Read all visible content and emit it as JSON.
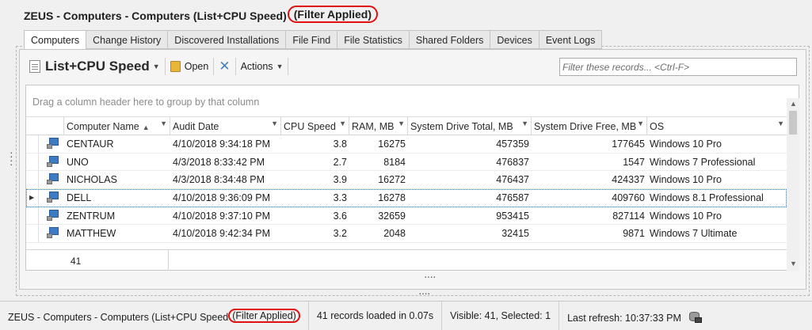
{
  "window": {
    "title": "ZEUS - Computers - Computers (List+CPU Speed)",
    "title_filter": "(Filter Applied)"
  },
  "tabs": [
    {
      "label": "Computers",
      "active": true
    },
    {
      "label": "Change History"
    },
    {
      "label": "Discovered Installations"
    },
    {
      "label": "File Find"
    },
    {
      "label": "File Statistics"
    },
    {
      "label": "Shared Folders"
    },
    {
      "label": "Devices"
    },
    {
      "label": "Event Logs"
    }
  ],
  "toolbar": {
    "view_name": "List+CPU Speed",
    "open_label": "Open",
    "actions_label": "Actions"
  },
  "filter": {
    "placeholder": "Filter these records... <Ctrl-F>"
  },
  "grid": {
    "group_panel_text": "Drag a column header here to group by that column",
    "columns": [
      "Computer Name",
      "Audit Date",
      "CPU Speed",
      "RAM, MB",
      "System Drive Total, MB",
      "System Drive Free, MB",
      "OS"
    ],
    "rows": [
      {
        "name": "CENTAUR",
        "date": "4/10/2018 9:34:18 PM",
        "cpu": "3.8",
        "ram": "16275",
        "total": "457359",
        "free": "177645",
        "os": "Windows 10 Pro"
      },
      {
        "name": "UNO",
        "date": "4/3/2018 8:33:42 PM",
        "cpu": "2.7",
        "ram": "8184",
        "total": "476837",
        "free": "1547",
        "os": "Windows 7 Professional"
      },
      {
        "name": "NICHOLAS",
        "date": "4/3/2018 8:34:48 PM",
        "cpu": "3.9",
        "ram": "16272",
        "total": "476437",
        "free": "424337",
        "os": "Windows 10 Pro"
      },
      {
        "name": "DELL",
        "date": "4/10/2018 9:36:09 PM",
        "cpu": "3.3",
        "ram": "16278",
        "total": "476587",
        "free": "409760",
        "os": "Windows 8.1 Professional",
        "selected": true
      },
      {
        "name": "ZENTRUM",
        "date": "4/10/2018 9:37:10 PM",
        "cpu": "3.6",
        "ram": "32659",
        "total": "953415",
        "free": "827114",
        "os": "Windows 10 Pro"
      },
      {
        "name": "MATTHEW",
        "date": "4/10/2018 9:42:34 PM",
        "cpu": "3.2",
        "ram": "2048",
        "total": "32415",
        "free": "9871",
        "os": "Windows 7 Ultimate"
      }
    ],
    "footer_count": "41"
  },
  "status_bar": {
    "title": "ZEUS - Computers - Computers (List+CPU Speed",
    "filter": "(Filter Applied)",
    "records": "41 records loaded in 0.07s",
    "visible": "Visible: 41, Selected: 1",
    "refresh": "Last refresh: 10:37:33 PM"
  }
}
